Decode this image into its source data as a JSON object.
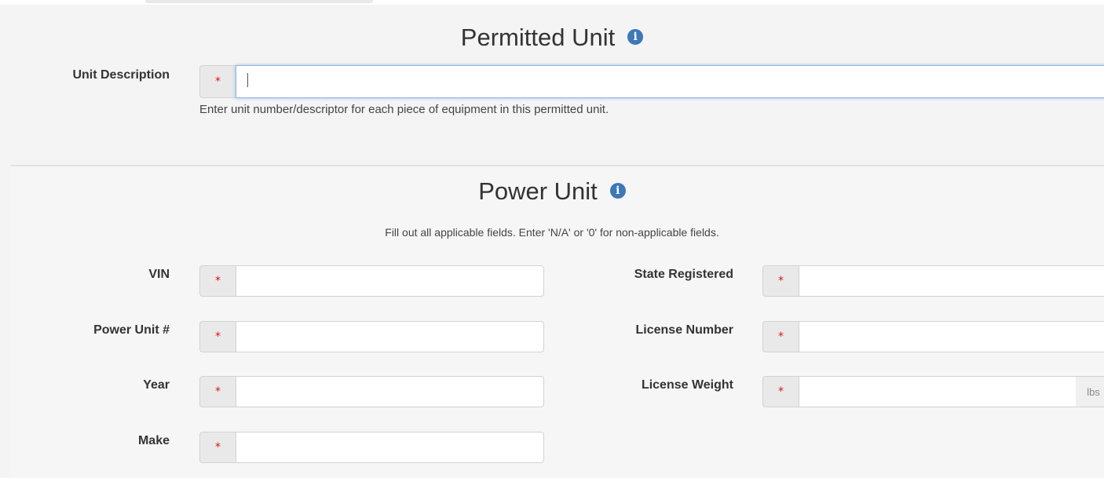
{
  "permitted_unit": {
    "title": "Permitted Unit",
    "info_icon": "info-circle-icon",
    "unit_description": {
      "label": "Unit Description",
      "value": "",
      "help": "Enter unit number/descriptor for each piece of equipment in this permitted unit."
    }
  },
  "power_unit": {
    "title": "Power Unit",
    "info_icon": "info-circle-icon",
    "subtitle": "Fill out all applicable fields. Enter 'N/A' or '0' for non-applicable fields.",
    "fields": {
      "vin": {
        "label": "VIN",
        "value": ""
      },
      "power_unit_number": {
        "label": "Power Unit #",
        "value": ""
      },
      "year": {
        "label": "Year",
        "value": ""
      },
      "make": {
        "label": "Make",
        "value": ""
      },
      "state_registered": {
        "label": "State Registered",
        "value": ""
      },
      "license_number": {
        "label": "License Number",
        "value": ""
      },
      "license_weight": {
        "label": "License Weight",
        "value": "",
        "unit": "lbs"
      }
    }
  },
  "required_marker": "*",
  "info_glyph": "i",
  "colors": {
    "info_icon": "#3d78b8",
    "required_marker": "#e01010",
    "focus_border": "#8cb5e6"
  }
}
